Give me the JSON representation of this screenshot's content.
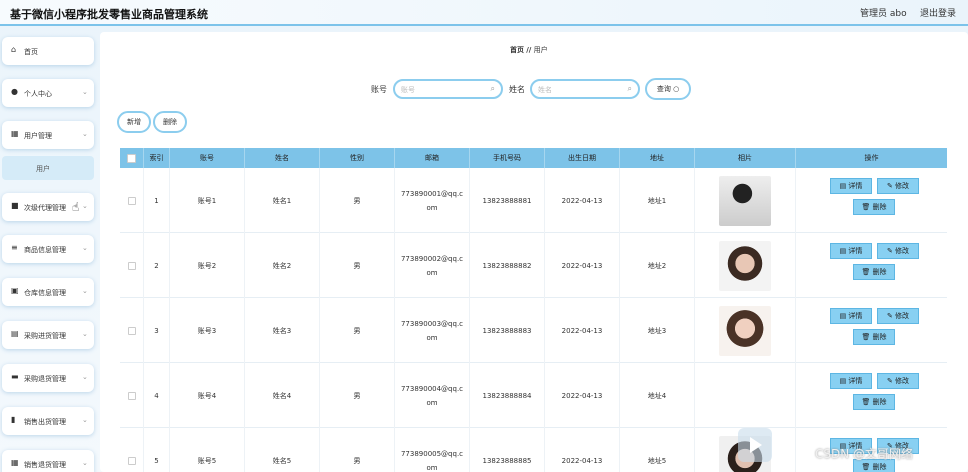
{
  "header": {
    "title": "基于微信小程序批发零售业商品管理系统",
    "admin": "管理员 abo",
    "logout": "退出登录"
  },
  "sidebar": {
    "items": [
      {
        "label": "首页",
        "icon": "home-icon",
        "chevron": false
      },
      {
        "label": "个人中心",
        "icon": "user-icon",
        "chevron": true
      },
      {
        "label": "用户管理",
        "icon": "grid-icon",
        "chevron": true
      },
      {
        "label": "次级代理管理",
        "icon": "agent-icon",
        "chevron": true
      },
      {
        "label": "商品信息管理",
        "icon": "sliders-icon",
        "chevron": true
      },
      {
        "label": "仓库信息管理",
        "icon": "warehouse-icon",
        "chevron": true
      },
      {
        "label": "采购进货管理",
        "icon": "purchase-icon",
        "chevron": true
      },
      {
        "label": "采购退货管理",
        "icon": "return-icon",
        "chevron": true
      },
      {
        "label": "销售出货管理",
        "icon": "bar-chart-icon",
        "chevron": true
      },
      {
        "label": "销售退货管理",
        "icon": "grid-icon",
        "chevron": true
      }
    ],
    "submenu": "用户"
  },
  "breadcrumb": {
    "home": "首页",
    "sep": "//",
    "current": "用户"
  },
  "search": {
    "account_label": "账号",
    "account_placeholder": "账号",
    "name_label": "姓名",
    "name_placeholder": "姓名",
    "query_label": "查询"
  },
  "actions": {
    "add": "新增",
    "delete": "删除"
  },
  "table": {
    "headers": [
      "索引",
      "账号",
      "姓名",
      "性别",
      "邮箱",
      "手机号码",
      "出生日期",
      "地址",
      "相片",
      "操作"
    ],
    "op_labels": {
      "detail": "详情",
      "edit": "修改",
      "delete": "删除"
    },
    "rows": [
      {
        "index": "1",
        "account": "账号1",
        "name": "姓名1",
        "gender": "男",
        "email_a": "773890001@qq.c",
        "email_b": "om",
        "phone": "13823888881",
        "birth": "2022-04-13",
        "address": "地址1"
      },
      {
        "index": "2",
        "account": "账号2",
        "name": "姓名2",
        "gender": "男",
        "email_a": "773890002@qq.c",
        "email_b": "om",
        "phone": "13823888882",
        "birth": "2022-04-13",
        "address": "地址2"
      },
      {
        "index": "3",
        "account": "账号3",
        "name": "姓名3",
        "gender": "男",
        "email_a": "773890003@qq.c",
        "email_b": "om",
        "phone": "13823888883",
        "birth": "2022-04-13",
        "address": "地址3"
      },
      {
        "index": "4",
        "account": "账号4",
        "name": "姓名4",
        "gender": "男",
        "email_a": "773890004@qq.c",
        "email_b": "om",
        "phone": "13823888884",
        "birth": "2022-04-13",
        "address": "地址4"
      },
      {
        "index": "5",
        "account": "账号5",
        "name": "姓名5",
        "gender": "男",
        "email_a": "773890005@qq.c",
        "email_b": "om",
        "phone": "13823888885",
        "birth": "2022-04-13",
        "address": "地址5"
      }
    ]
  },
  "watermark": "CSDN @文哥网络",
  "colors": {
    "accent": "#7dc3e8",
    "button": "#88d0f2",
    "border": "#8ccdee"
  }
}
